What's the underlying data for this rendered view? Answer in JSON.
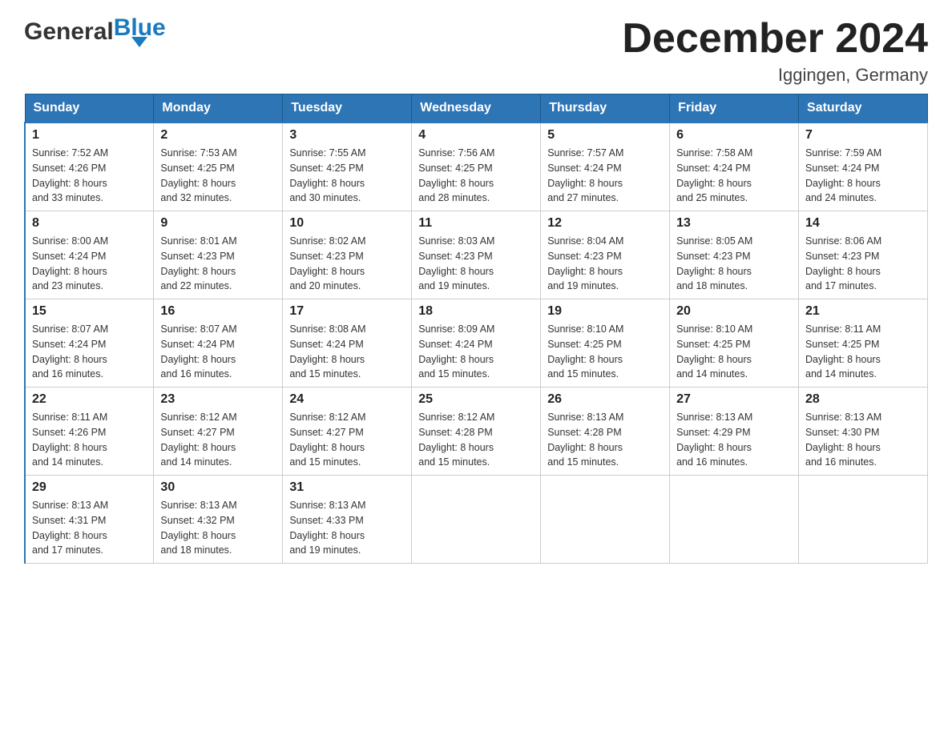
{
  "logo": {
    "general": "General",
    "blue": "Blue"
  },
  "title": "December 2024",
  "subtitle": "Iggingen, Germany",
  "days_of_week": [
    "Sunday",
    "Monday",
    "Tuesday",
    "Wednesday",
    "Thursday",
    "Friday",
    "Saturday"
  ],
  "weeks": [
    [
      {
        "day": "1",
        "sunrise": "7:52 AM",
        "sunset": "4:26 PM",
        "daylight": "8 hours and 33 minutes."
      },
      {
        "day": "2",
        "sunrise": "7:53 AM",
        "sunset": "4:25 PM",
        "daylight": "8 hours and 32 minutes."
      },
      {
        "day": "3",
        "sunrise": "7:55 AM",
        "sunset": "4:25 PM",
        "daylight": "8 hours and 30 minutes."
      },
      {
        "day": "4",
        "sunrise": "7:56 AM",
        "sunset": "4:25 PM",
        "daylight": "8 hours and 28 minutes."
      },
      {
        "day": "5",
        "sunrise": "7:57 AM",
        "sunset": "4:24 PM",
        "daylight": "8 hours and 27 minutes."
      },
      {
        "day": "6",
        "sunrise": "7:58 AM",
        "sunset": "4:24 PM",
        "daylight": "8 hours and 25 minutes."
      },
      {
        "day": "7",
        "sunrise": "7:59 AM",
        "sunset": "4:24 PM",
        "daylight": "8 hours and 24 minutes."
      }
    ],
    [
      {
        "day": "8",
        "sunrise": "8:00 AM",
        "sunset": "4:24 PM",
        "daylight": "8 hours and 23 minutes."
      },
      {
        "day": "9",
        "sunrise": "8:01 AM",
        "sunset": "4:23 PM",
        "daylight": "8 hours and 22 minutes."
      },
      {
        "day": "10",
        "sunrise": "8:02 AM",
        "sunset": "4:23 PM",
        "daylight": "8 hours and 20 minutes."
      },
      {
        "day": "11",
        "sunrise": "8:03 AM",
        "sunset": "4:23 PM",
        "daylight": "8 hours and 19 minutes."
      },
      {
        "day": "12",
        "sunrise": "8:04 AM",
        "sunset": "4:23 PM",
        "daylight": "8 hours and 19 minutes."
      },
      {
        "day": "13",
        "sunrise": "8:05 AM",
        "sunset": "4:23 PM",
        "daylight": "8 hours and 18 minutes."
      },
      {
        "day": "14",
        "sunrise": "8:06 AM",
        "sunset": "4:23 PM",
        "daylight": "8 hours and 17 minutes."
      }
    ],
    [
      {
        "day": "15",
        "sunrise": "8:07 AM",
        "sunset": "4:24 PM",
        "daylight": "8 hours and 16 minutes."
      },
      {
        "day": "16",
        "sunrise": "8:07 AM",
        "sunset": "4:24 PM",
        "daylight": "8 hours and 16 minutes."
      },
      {
        "day": "17",
        "sunrise": "8:08 AM",
        "sunset": "4:24 PM",
        "daylight": "8 hours and 15 minutes."
      },
      {
        "day": "18",
        "sunrise": "8:09 AM",
        "sunset": "4:24 PM",
        "daylight": "8 hours and 15 minutes."
      },
      {
        "day": "19",
        "sunrise": "8:10 AM",
        "sunset": "4:25 PM",
        "daylight": "8 hours and 15 minutes."
      },
      {
        "day": "20",
        "sunrise": "8:10 AM",
        "sunset": "4:25 PM",
        "daylight": "8 hours and 14 minutes."
      },
      {
        "day": "21",
        "sunrise": "8:11 AM",
        "sunset": "4:25 PM",
        "daylight": "8 hours and 14 minutes."
      }
    ],
    [
      {
        "day": "22",
        "sunrise": "8:11 AM",
        "sunset": "4:26 PM",
        "daylight": "8 hours and 14 minutes."
      },
      {
        "day": "23",
        "sunrise": "8:12 AM",
        "sunset": "4:27 PM",
        "daylight": "8 hours and 14 minutes."
      },
      {
        "day": "24",
        "sunrise": "8:12 AM",
        "sunset": "4:27 PM",
        "daylight": "8 hours and 15 minutes."
      },
      {
        "day": "25",
        "sunrise": "8:12 AM",
        "sunset": "4:28 PM",
        "daylight": "8 hours and 15 minutes."
      },
      {
        "day": "26",
        "sunrise": "8:13 AM",
        "sunset": "4:28 PM",
        "daylight": "8 hours and 15 minutes."
      },
      {
        "day": "27",
        "sunrise": "8:13 AM",
        "sunset": "4:29 PM",
        "daylight": "8 hours and 16 minutes."
      },
      {
        "day": "28",
        "sunrise": "8:13 AM",
        "sunset": "4:30 PM",
        "daylight": "8 hours and 16 minutes."
      }
    ],
    [
      {
        "day": "29",
        "sunrise": "8:13 AM",
        "sunset": "4:31 PM",
        "daylight": "8 hours and 17 minutes."
      },
      {
        "day": "30",
        "sunrise": "8:13 AM",
        "sunset": "4:32 PM",
        "daylight": "8 hours and 18 minutes."
      },
      {
        "day": "31",
        "sunrise": "8:13 AM",
        "sunset": "4:33 PM",
        "daylight": "8 hours and 19 minutes."
      },
      null,
      null,
      null,
      null
    ]
  ],
  "labels": {
    "sunrise": "Sunrise:",
    "sunset": "Sunset:",
    "daylight": "Daylight:"
  },
  "colors": {
    "header_bg": "#2e75b6",
    "header_text": "#ffffff",
    "border": "#2e75b6"
  }
}
